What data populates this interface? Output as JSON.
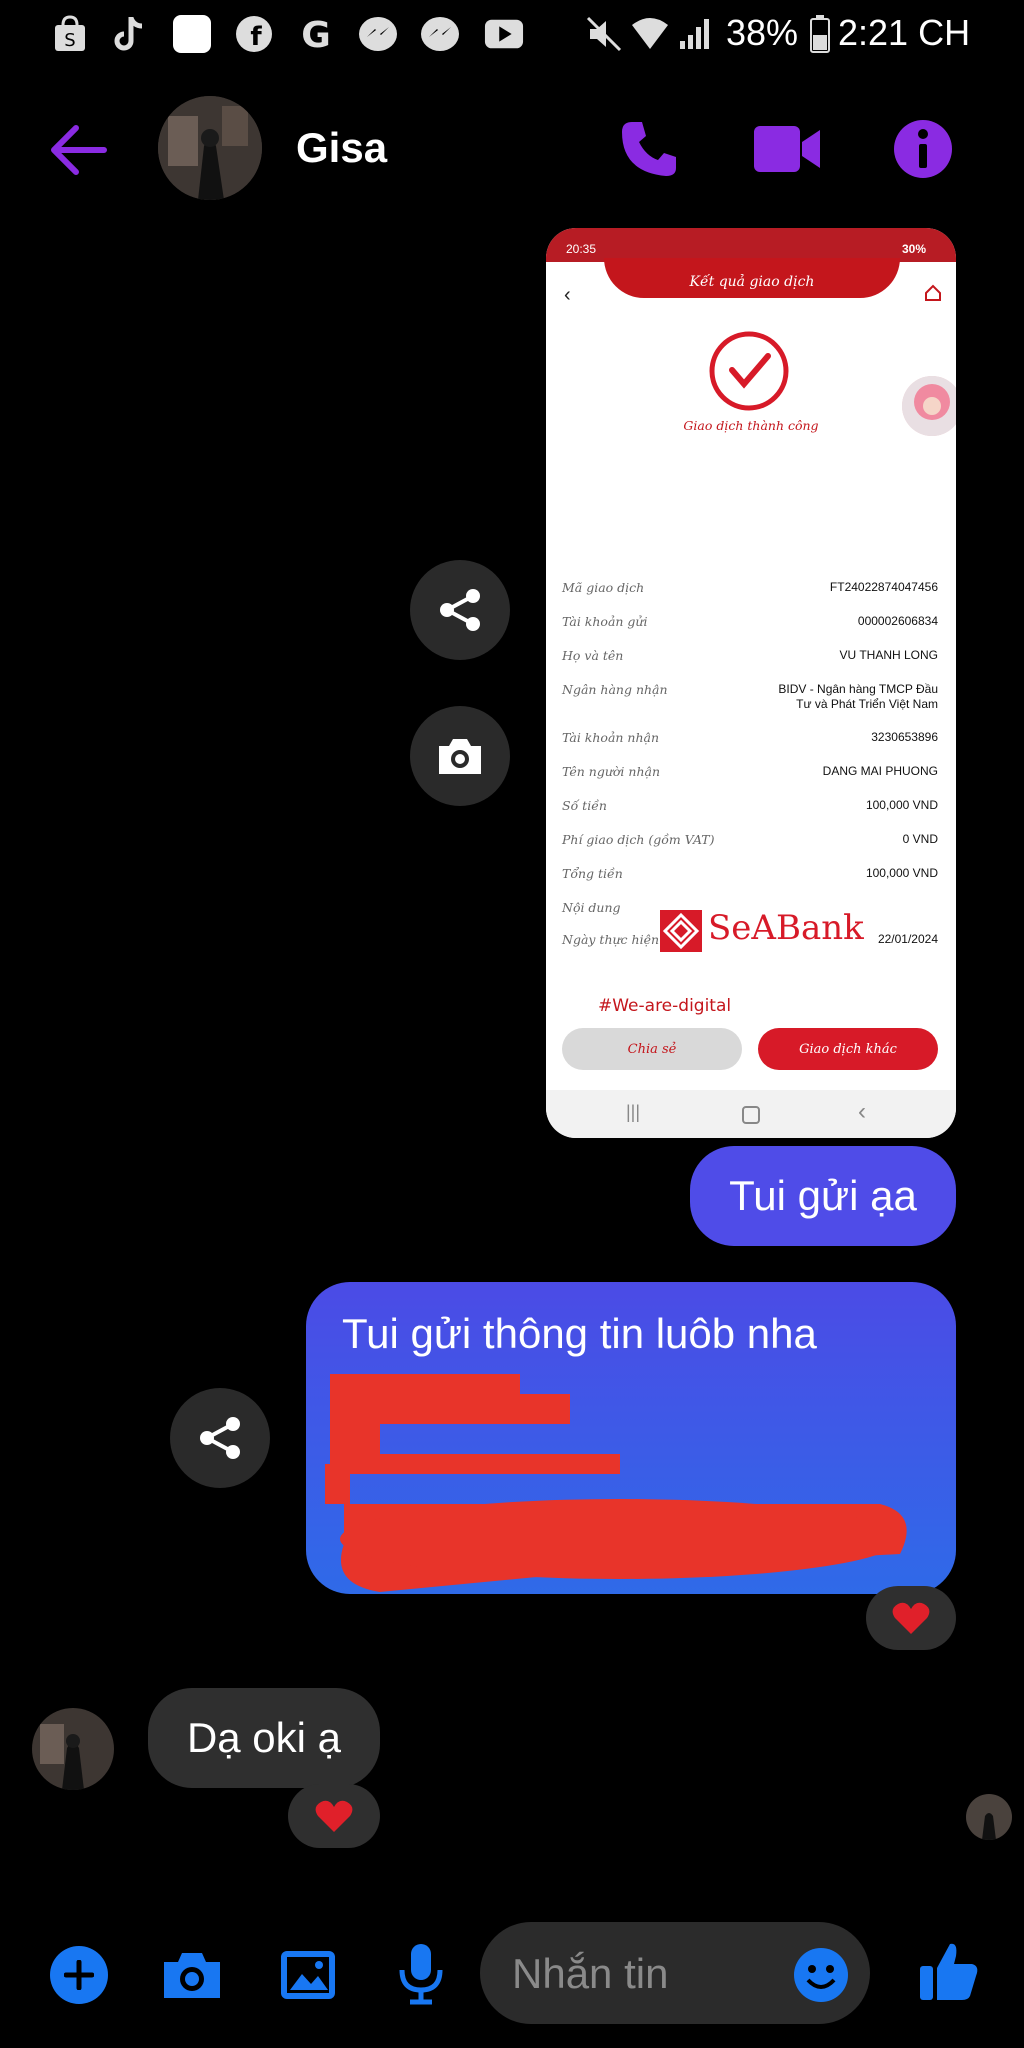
{
  "status_bar": {
    "battery": "38%",
    "time": "2:21 CH",
    "app_icons": [
      "shopee-icon",
      "tiktok-icon",
      "square-app-icon",
      "facebook-icon",
      "google-icon",
      "messenger-icon",
      "messenger-icon",
      "youtube-icon"
    ]
  },
  "header": {
    "contact_name": "Gisa"
  },
  "receipt": {
    "status_time": "20:35",
    "status_battery": "30%",
    "title": "Kết quả giao dịch",
    "success_text": "Giao dịch thành công",
    "rows": [
      {
        "label": "Mã giao dịch",
        "value": "FT24022874047456"
      },
      {
        "label": "Tài khoản gửi",
        "value": "000002606834"
      },
      {
        "label": "Họ và tên",
        "value": "VU THANH LONG"
      },
      {
        "label": "Ngân hàng nhận",
        "value": "BIDV - Ngân hàng TMCP Đầu Tư và Phát Triển Việt Nam"
      },
      {
        "label": "Tài khoản nhận",
        "value": "3230653896"
      },
      {
        "label": "Tên người nhận",
        "value": "DANG MAI PHUONG"
      },
      {
        "label": "Số tiền",
        "value": "100,000 VND"
      },
      {
        "label": "Phí giao dịch (gồm VAT)",
        "value": "0 VND"
      },
      {
        "label": "Tổng tiền",
        "value": "100,000 VND"
      },
      {
        "label": "Nội dung",
        "value": ""
      },
      {
        "label": "Ngày thực hiện",
        "value": "22/01/2024"
      }
    ],
    "brand": "SeABank",
    "hashtag": "#We-are-digital",
    "share_button": "Chia sẻ",
    "other_button": "Giao dịch khác"
  },
  "messages": {
    "sent_1": "Tui gửi ạa",
    "sent_2": "Tui gửi thông tin luôb nha",
    "received_1": "Dạ oki ạ"
  },
  "composer": {
    "placeholder": "Nhắn tin"
  },
  "colors": {
    "accent_purple": "#8a2be2",
    "bubble_purple": "#4f4ce8",
    "composer_blue": "#1877f2",
    "seabank_red": "#d71a28"
  }
}
